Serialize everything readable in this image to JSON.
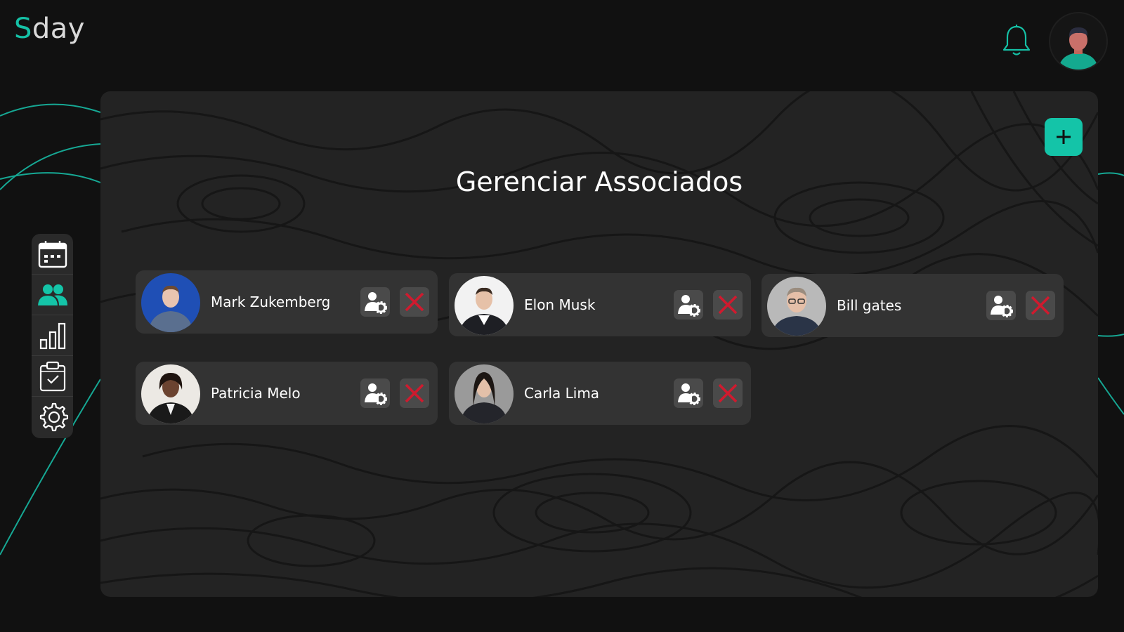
{
  "app": {
    "logo_first": "S",
    "logo_rest": "day"
  },
  "header": {
    "notification_icon": "bell-icon",
    "profile_icon": "user-avatar"
  },
  "sidebar": {
    "items": [
      {
        "icon": "calendar-icon",
        "active": false
      },
      {
        "icon": "users-icon",
        "active": true
      },
      {
        "icon": "bar-chart-icon",
        "active": false
      },
      {
        "icon": "clipboard-check-icon",
        "active": false
      },
      {
        "icon": "gear-icon",
        "active": false
      }
    ]
  },
  "main": {
    "title": "Gerenciar Associados",
    "add_icon": "plus-icon",
    "associates": [
      {
        "name": "Mark Zukemberg"
      },
      {
        "name": "Elon Musk"
      },
      {
        "name": "Bill gates"
      },
      {
        "name": "Patricia Melo"
      },
      {
        "name": "Carla Lima"
      }
    ]
  },
  "colors": {
    "accent": "#14c4a8",
    "background": "#111111",
    "panel": "#232323",
    "card": "#333333",
    "remove_x": "#d01a2e"
  }
}
